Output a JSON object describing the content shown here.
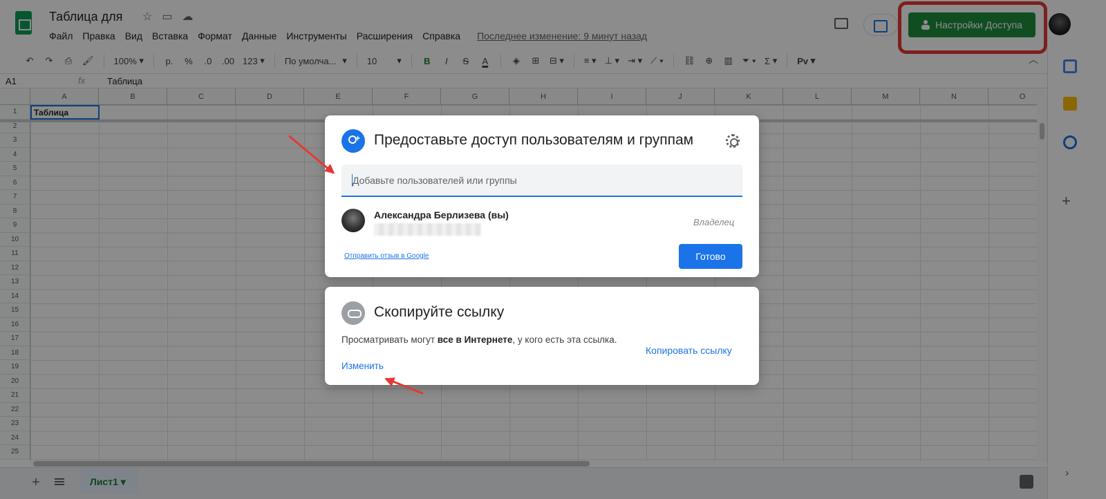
{
  "header": {
    "doc_title": "Таблица для",
    "menu": [
      "Файл",
      "Правка",
      "Вид",
      "Вставка",
      "Формат",
      "Данные",
      "Инструменты",
      "Расширения",
      "Справка"
    ],
    "last_edit": "Последнее изменение: 9 минут назад",
    "share_button": "Настройки Доступа"
  },
  "toolbar": {
    "zoom": "100%",
    "currency": "р.",
    "percent": "%",
    "dec_decrease": ".0",
    "dec_increase": ".00",
    "more_formats": "123",
    "font": "По умолча...",
    "font_size": "10",
    "bold": "B",
    "italic": "I",
    "strike": "S",
    "text_color": "A",
    "sum": "Σ",
    "input_tools": "Pv"
  },
  "formula_bar": {
    "cell_ref": "A1",
    "fx": "fx",
    "value": "Таблица"
  },
  "grid": {
    "columns": [
      "A",
      "B",
      "C",
      "D",
      "E",
      "F",
      "G",
      "H",
      "I",
      "J",
      "K",
      "L",
      "M",
      "N",
      "O"
    ],
    "rows": [
      "1",
      "2",
      "3",
      "4",
      "5",
      "6",
      "7",
      "8",
      "9",
      "10",
      "11",
      "12",
      "13",
      "14",
      "15",
      "16",
      "17",
      "18",
      "19",
      "20",
      "21",
      "22",
      "23",
      "24",
      "25"
    ],
    "a1_value": "Таблица"
  },
  "bottom": {
    "sheet_tab": "Лист1"
  },
  "share_dialog": {
    "title": "Предоставьте доступ пользователям и группам",
    "input_placeholder": "Добавьте пользователей или группы",
    "owner_name": "Александра Берлизева (вы)",
    "owner_role": "Владелец",
    "feedback_link": "Отправить отзыв в Google",
    "done_button": "Готово"
  },
  "link_dialog": {
    "title": "Скопируйте ссылку",
    "desc_prefix": "Просматривать могут ",
    "desc_bold": "все в Интернете",
    "desc_suffix": ", у кого есть эта ссылка.",
    "change_link": "Изменить",
    "copy_link": "Копировать ссылку"
  },
  "colors": {
    "share_green": "#1e8e3e",
    "accent_blue": "#1a73e8",
    "annotation_red": "#e53935"
  }
}
